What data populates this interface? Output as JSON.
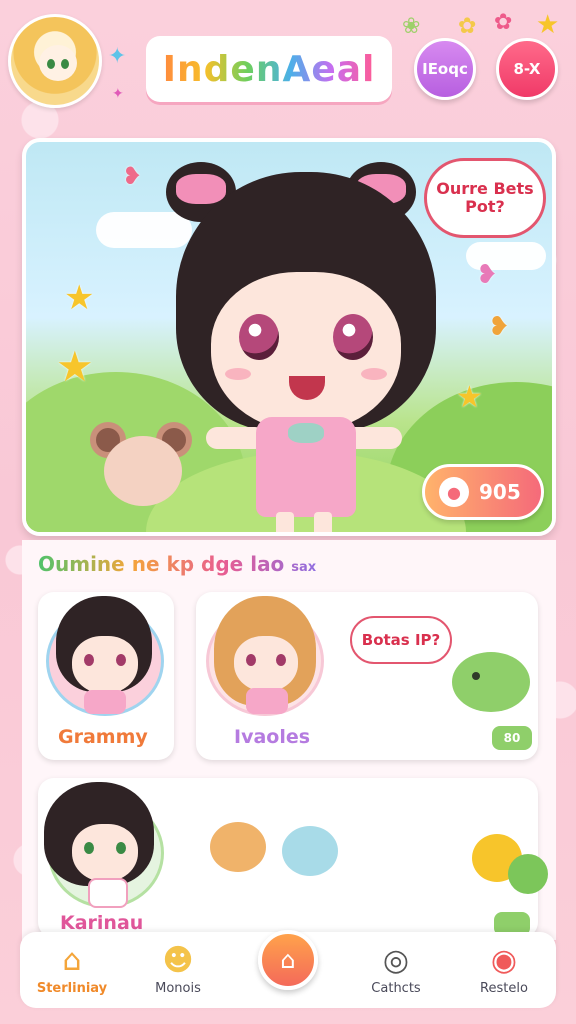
{
  "header": {
    "logo_text": "IndenAeal",
    "btn_left_label": "IEoqc",
    "btn_right_label": "8-X"
  },
  "hero": {
    "speech_text": "Ourre Bets Pot?",
    "score_value": "905"
  },
  "section": {
    "title": "Oumine ne kp dge lao",
    "title_small": "sax",
    "cards": [
      {
        "label": "Grammy",
        "color": "#f07a3a"
      },
      {
        "label": "Ivaoles",
        "color": "#b57be0"
      },
      {
        "label": "Karinau",
        "color": "#e0569a"
      }
    ],
    "card2_speech": "Botas IP?",
    "card2_tag": "80"
  },
  "nav": {
    "items": [
      {
        "label": "Sterliniay",
        "icon": "home-icon"
      },
      {
        "label": "Monois",
        "icon": "pet-icon"
      },
      {
        "label": "",
        "icon": "center-add-icon"
      },
      {
        "label": "Cathcts",
        "icon": "target-icon"
      },
      {
        "label": "Restelo",
        "icon": "egg-icon"
      }
    ]
  },
  "colors": {
    "accent": "#f08a2a",
    "pink_bg": "#fbd3df",
    "purple_btn": "#c76fe8",
    "red_btn": "#f24b72"
  }
}
